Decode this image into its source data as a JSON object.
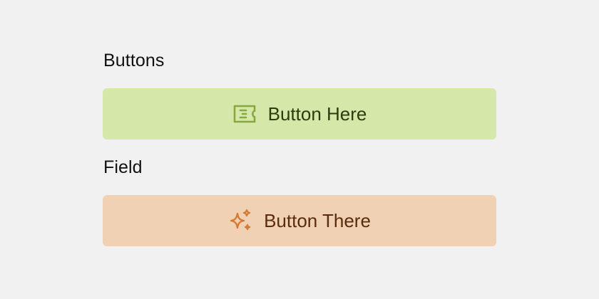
{
  "sections": [
    {
      "title": "Buttons",
      "button": {
        "label": "Button Here",
        "icon": "ticket-icon",
        "background": "#d6e8a9",
        "icon_color": "#86a83e",
        "text_color": "#2c3c0c"
      }
    },
    {
      "title": "Field",
      "button": {
        "label": "Button There",
        "icon": "sparkles-icon",
        "background": "#f1d1b4",
        "icon_color": "#d47a35",
        "text_color": "#5b2c0c"
      }
    }
  ],
  "page": {
    "background": "#f1f1f1"
  }
}
